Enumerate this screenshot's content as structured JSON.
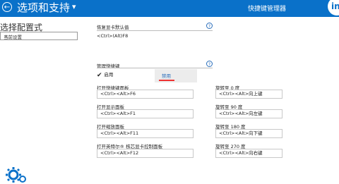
{
  "header": {
    "title": "选项和支持",
    "back_icon": "back-arrow-icon",
    "menu_icon": "chevron-down-icon",
    "section_title": "快捷键管理器",
    "brand": "int"
  },
  "left": {
    "title": "选择配置式",
    "select_value": "当前设置"
  },
  "restore": {
    "label": "恢复显卡默认值",
    "value": "<Ctrl>(Alt)F8"
  },
  "manage": {
    "label": "管理快捷键",
    "enabled_label": "启用",
    "popup_option": "禁用"
  },
  "hotkeys_left": [
    {
      "label": "打开快捷键面板",
      "value": "<Ctrl><Alt>F6"
    },
    {
      "label": "打开显示面板",
      "value": "<Ctrl><Alt>F1"
    },
    {
      "label": "打开缩放面板",
      "value": "<Ctrl><Alt>F11"
    },
    {
      "label": "打开英特尔® 核芯显卡控制面板",
      "value": "<Ctrl><Alt>F12"
    }
  ],
  "hotkeys_right": [
    {
      "label": "旋转至 0 度",
      "value": "<Ctrl><Alt>向上键"
    },
    {
      "label": "旋转至 90 度",
      "value": "<Ctrl><Alt>向左键"
    },
    {
      "label": "旋转至 180 度",
      "value": "<Ctrl><Alt>向下键"
    },
    {
      "label": "旋转至 270 度",
      "value": "<Ctrl><Alt>向右键"
    }
  ]
}
